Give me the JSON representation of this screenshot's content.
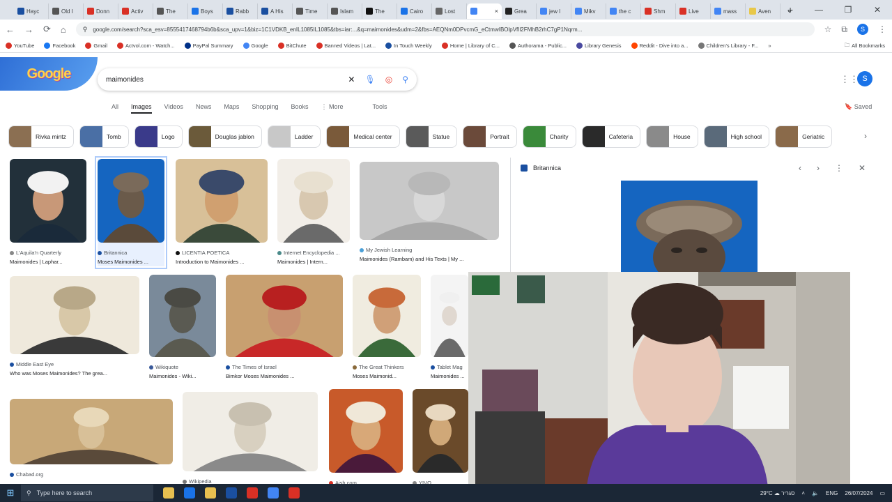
{
  "browser": {
    "tabs": [
      {
        "label": "Hayc",
        "color": "#1a4fa0"
      },
      {
        "label": "Old I",
        "color": "#555"
      },
      {
        "label": "Donn",
        "color": "#d93025"
      },
      {
        "label": "Activ",
        "color": "#d93025"
      },
      {
        "label": "The ",
        "color": "#555"
      },
      {
        "label": "Boys",
        "color": "#1a73e8"
      },
      {
        "label": "Rabb",
        "color": "#1a4fa0"
      },
      {
        "label": "A His",
        "color": "#1a4fa0"
      },
      {
        "label": "Time",
        "color": "#555"
      },
      {
        "label": "Islam",
        "color": "#555"
      },
      {
        "label": "The ",
        "color": "#111"
      },
      {
        "label": "Cairo",
        "color": "#1a73e8"
      },
      {
        "label": "Lost ",
        "color": "#666"
      },
      {
        "label": "",
        "color": "#4285f4"
      },
      {
        "label": "Grea",
        "color": "#222"
      },
      {
        "label": "jew l",
        "color": "#4285f4"
      },
      {
        "label": "Mikv",
        "color": "#4285f4"
      },
      {
        "label": "the c",
        "color": "#4285f4"
      },
      {
        "label": "Shm",
        "color": "#d93025"
      },
      {
        "label": "Live ",
        "color": "#d93025"
      },
      {
        "label": "mass",
        "color": "#4285f4"
      },
      {
        "label": "Aven",
        "color": "#e8c84a"
      }
    ],
    "tab_close": "×",
    "new_tab": "+",
    "window_controls": [
      "⌄",
      "—",
      "❐",
      "✕"
    ],
    "url": "google.com/search?sca_esv=8555417468794b6b&sca_upv=1&biz=1C1VDKB_enIL1085IL1085&tbs=iar:...&q=maimonides&udm=2&fbs=AEQNm0DPvcmG_eCtmwIBOlpVfIl2FMhB2rhC7gP1Nqrm...",
    "bookmarks": [
      {
        "label": "YouTube",
        "color": "#d93025"
      },
      {
        "label": "Facebook",
        "color": "#1877f2"
      },
      {
        "label": "Gmail",
        "color": "#d93025"
      },
      {
        "label": "Actvol.com - Watch...",
        "color": "#d93025"
      },
      {
        "label": "PayPal Summary",
        "color": "#003087"
      },
      {
        "label": "Google",
        "color": "#4285f4"
      },
      {
        "label": "BitChute",
        "color": "#d93025"
      },
      {
        "label": "Banned Videos | Lat...",
        "color": "#d93025"
      },
      {
        "label": "In Touch Weekly",
        "color": "#1a4fa0"
      },
      {
        "label": "Home | Library of C...",
        "color": "#d93025"
      },
      {
        "label": "Authorama - Public...",
        "color": "#555"
      },
      {
        "label": "Library Genesis",
        "color": "#4a4aa0"
      },
      {
        "label": "Reddit - Dive into a...",
        "color": "#ff4500"
      },
      {
        "label": "Children's Library - F...",
        "color": "#777"
      }
    ],
    "all_bookmarks": "All Bookmarks"
  },
  "google": {
    "doodle": "Google",
    "query": "maimonides",
    "profile_initial": "S",
    "tabs": [
      "All",
      "Images",
      "Videos",
      "News",
      "Maps",
      "Shopping",
      "Books",
      "⋮ More"
    ],
    "tools": "Tools",
    "saved": "Saved",
    "chips": [
      {
        "label": "Rivka mintz",
        "color": "#8b6f52"
      },
      {
        "label": "Tomb",
        "color": "#4a6fa5"
      },
      {
        "label": "Logo",
        "color": "#3a3a8a"
      },
      {
        "label": "Douglas jablon",
        "color": "#6b5a3a"
      },
      {
        "label": "Ladder",
        "color": "#c8c8c8"
      },
      {
        "label": "Medical center",
        "color": "#7a5a3a"
      },
      {
        "label": "Statue",
        "color": "#5a5a5a"
      },
      {
        "label": "Portrait",
        "color": "#6b4a3a"
      },
      {
        "label": "Charity",
        "color": "#3a8a3a"
      },
      {
        "label": "Cafeteria",
        "color": "#2a2a2a"
      },
      {
        "label": "House",
        "color": "#8a8a8a"
      },
      {
        "label": "High school",
        "color": "#5a6a7a"
      },
      {
        "label": "Geriatric",
        "color": "#8a6a4a"
      }
    ],
    "results": [
      {
        "source": "L'Aquila'n Quarterly",
        "title": "Maimonides | Laphar...",
        "bg": "#22303a",
        "face": "#c89878",
        "hat": "#f2f2f2",
        "robe": "#1a2a3a",
        "dot": "#888"
      },
      {
        "source": "Britannica",
        "title": "Moses Maimonides ...",
        "bg": "#1565c0",
        "face": "#6a5a4a",
        "hat": "#7a6a5a",
        "robe": "#5a4a3a",
        "dot": "#1a4fa0"
      },
      {
        "source": "LICENTIA POETICA",
        "title": "Introduction to Maimonides ...",
        "bg": "#d8c098",
        "face": "#d0a070",
        "hat": "#3a4a6a",
        "robe": "#3a4a3a",
        "dot": "#111"
      },
      {
        "source": "Internet Encyclopedia ...",
        "title": "Maimonides | Intern...",
        "bg": "#f2eee8",
        "face": "#d8c8b0",
        "hat": "#e8e0d0",
        "robe": "#6a6a6a",
        "dot": "#4a8a8a"
      },
      {
        "source": "My Jewish Learning",
        "title": "Maimonides (Rambam) and His Texts | My ...",
        "bg": "#c8c8c8",
        "face": "#d8d8d8",
        "hat": "#b8b8b8",
        "robe": "#a8a8a8",
        "dot": "#4aa0d8"
      },
      {
        "source": "Middle East Eye",
        "title": "Who was Moses Maimonides? The grea...",
        "bg": "#efe9dc",
        "face": "#d8c8a8",
        "hat": "#b8a888",
        "robe": "#3a3a3a",
        "dot": "#1a4fa0"
      },
      {
        "source": "Wikiquote",
        "title": "Maimonides - Wiki...",
        "bg": "#7a8a9a",
        "face": "#5a5a52",
        "hat": "#4a4a44",
        "robe": "#5a5a50",
        "dot": "#3a5a9a"
      },
      {
        "source": "The Times of Israel",
        "title": "Bimkor Moses Maimonides ...",
        "bg": "#c8a070",
        "face": "#c89070",
        "hat": "#b82020",
        "robe": "#c82828",
        "dot": "#1a4fa0"
      },
      {
        "source": "The Great Thinkers",
        "title": "Moses Maimonid...",
        "bg": "#f0ece0",
        "face": "#d0a078",
        "hat": "#c86a3a",
        "robe": "#3a6a3a",
        "dot": "#8a6a3a"
      },
      {
        "source": "Tablet Mag",
        "title": "Maimonides ...",
        "bg": "#f4f4f4",
        "face": "#e0d8d0",
        "hat": "#f0f0f0",
        "robe": "#6a6a6a",
        "dot": "#1a4fa0"
      },
      {
        "source": "Chabad.org",
        "title": "",
        "bg": "#c8a878",
        "face": "#d8c098",
        "hat": "#e8d8b8",
        "robe": "#5a4a3a",
        "dot": "#1a4fa0"
      },
      {
        "source": "Wikipedia",
        "title": "",
        "bg": "#f0ede6",
        "face": "#d8d0c0",
        "hat": "#c8c0b0",
        "robe": "#8a8a8a",
        "dot": "#777"
      },
      {
        "source": "Aish.com",
        "title": "",
        "bg": "#c85a2a",
        "face": "#d8a878",
        "hat": "#f0e8d8",
        "robe": "#4a1a3a",
        "dot": "#d93025"
      },
      {
        "source": "YIVO",
        "title": "",
        "bg": "#6a4a2a",
        "face": "#d0a878",
        "hat": "#e8d8c0",
        "robe": "#2a2a2a",
        "dot": "#888"
      }
    ],
    "panel": {
      "source": "Britannica",
      "controls": [
        "‹",
        "›",
        "⋮",
        "✕"
      ]
    }
  },
  "taskbar": {
    "start": "⊞",
    "search_placeholder": "Type here to search",
    "weather": "29°C ☁ סגריר",
    "lang": "ENG",
    "time": "",
    "date": "26/07/2024",
    "apps": [
      "#e8c050",
      "#1a73e8",
      "#e8c050",
      "#1a4fa0",
      "#d93025",
      "#4285f4",
      "#d93025"
    ]
  }
}
